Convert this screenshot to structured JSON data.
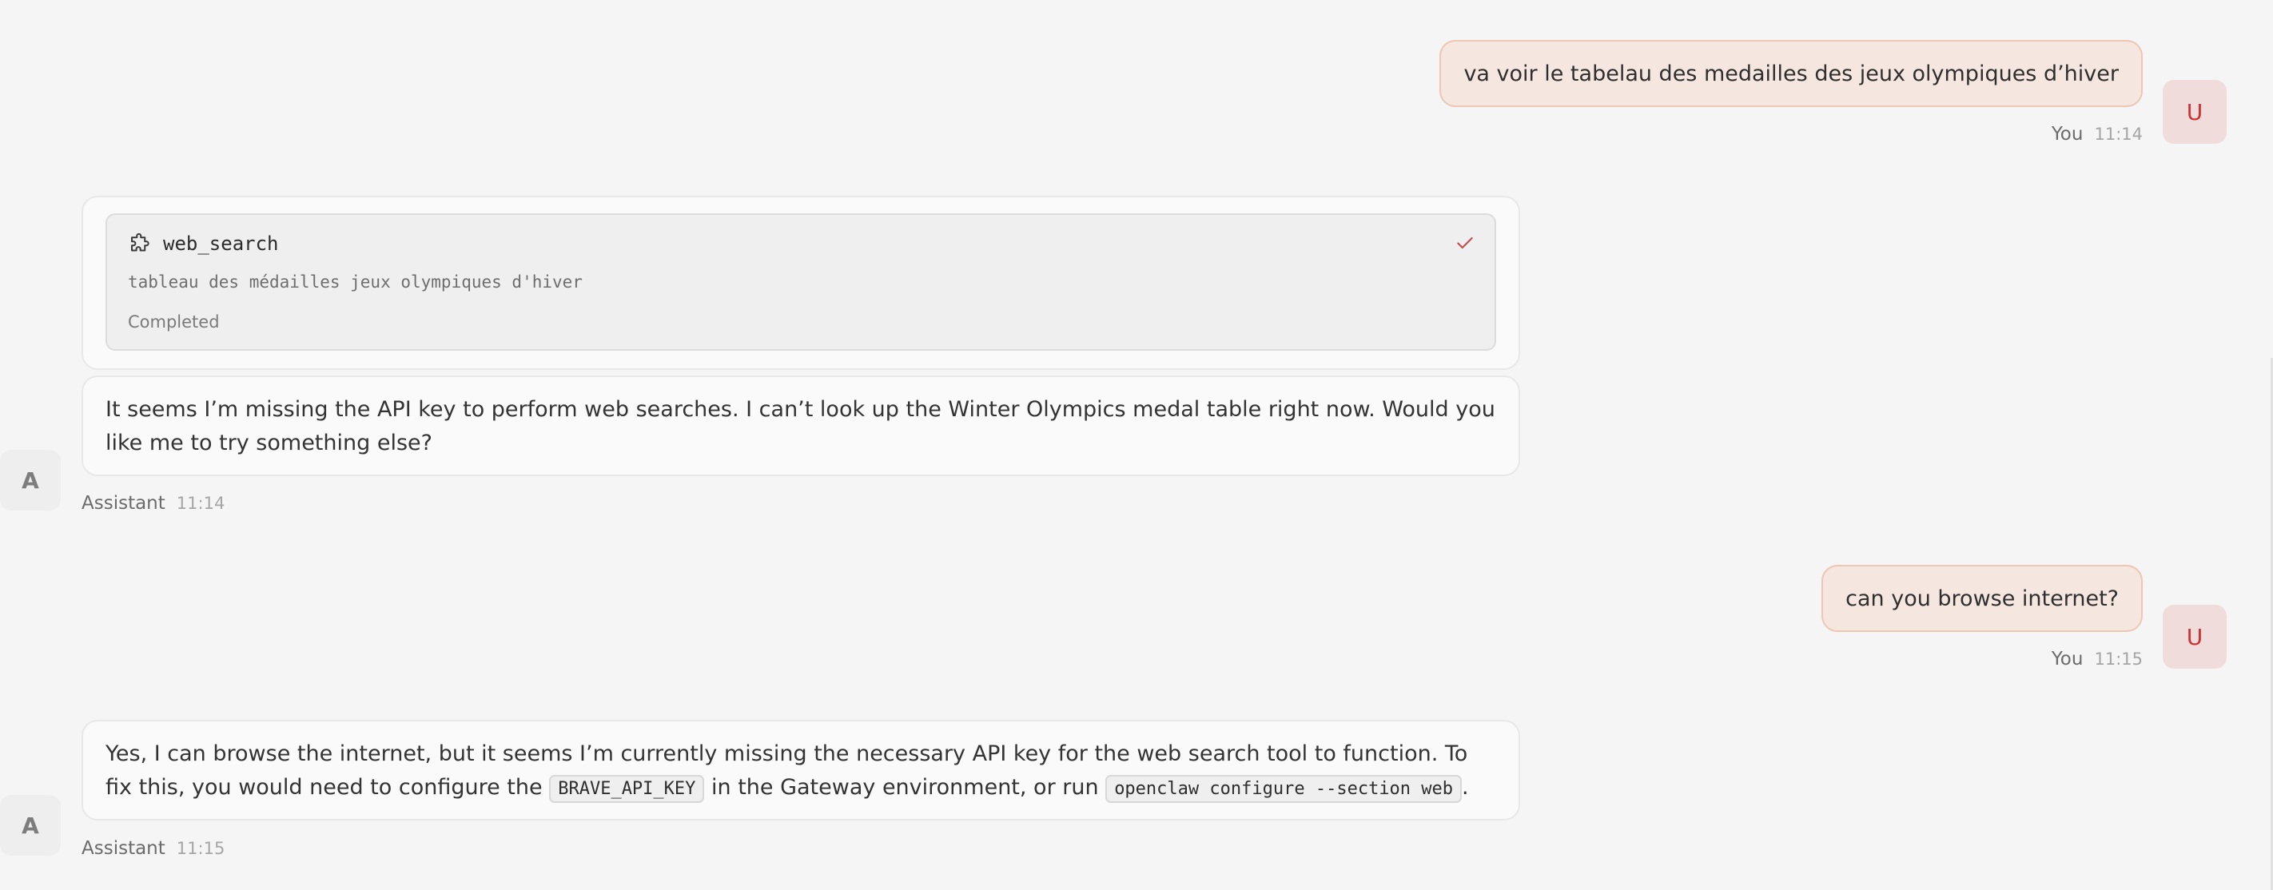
{
  "messages": [
    {
      "role": "user",
      "text": "va voir le tabelau des medailles des jeux olympiques d’hiver",
      "author": "You",
      "time": "11:14",
      "avatar": "U"
    },
    {
      "role": "assistant",
      "tool": {
        "icon": "puzzle-icon",
        "name": "web_search",
        "args": "tableau des médailles jeux olympiques d'hiver",
        "status": "Completed",
        "status_icon": "check-icon"
      },
      "text": "It seems I’m missing the API key to perform web searches. I can’t look up the Winter Olympics medal table right now. Would you like me to try something else?",
      "author": "Assistant",
      "time": "11:14",
      "avatar": "A"
    },
    {
      "role": "user",
      "text": "can you browse internet?",
      "author": "You",
      "time": "11:15",
      "avatar": "U"
    },
    {
      "role": "assistant",
      "text_part1": "Yes, I can browse the internet, but it seems I’m currently missing the necessary API key for the web search tool to function. To fix this, you would need to configure the",
      "code1": "BRAVE_API_KEY",
      "text_part2": "in the Gateway environment, or run",
      "code2": "openclaw configure --section web",
      "text_part3": ".",
      "author": "Assistant",
      "time": "11:15",
      "avatar": "A"
    }
  ],
  "colors": {
    "background": "#f5f5f5",
    "user_bubble": "#f5e7df",
    "user_border": "#ecc7b3",
    "user_avatar_bg": "#f1dcdc",
    "user_avatar_fg": "#d03232",
    "check": "#c0504d"
  }
}
